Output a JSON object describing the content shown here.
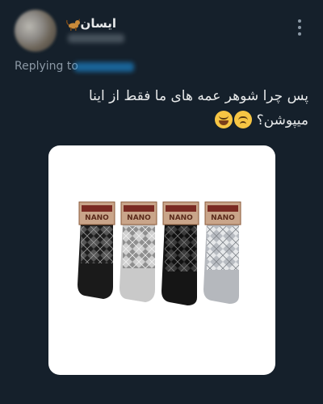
{
  "header": {
    "display_name": "ایسان",
    "name_emoji_icon": "dog-emoji-icon",
    "more_icon": "more-vertical-icon"
  },
  "reply": {
    "label": "Replying to"
  },
  "tweet": {
    "text": "پس چرا شوهر عمه های ما فقط از اینا میپوشن؟",
    "emoji_icons": [
      "weary-face-emoji-icon",
      "grinning-sweat-emoji-icon"
    ]
  },
  "media": {
    "sock_brand": "NANO",
    "sock_colors": [
      "#1a1a1a",
      "#c9c9c9",
      "#151515",
      "#b5b8bd"
    ]
  }
}
